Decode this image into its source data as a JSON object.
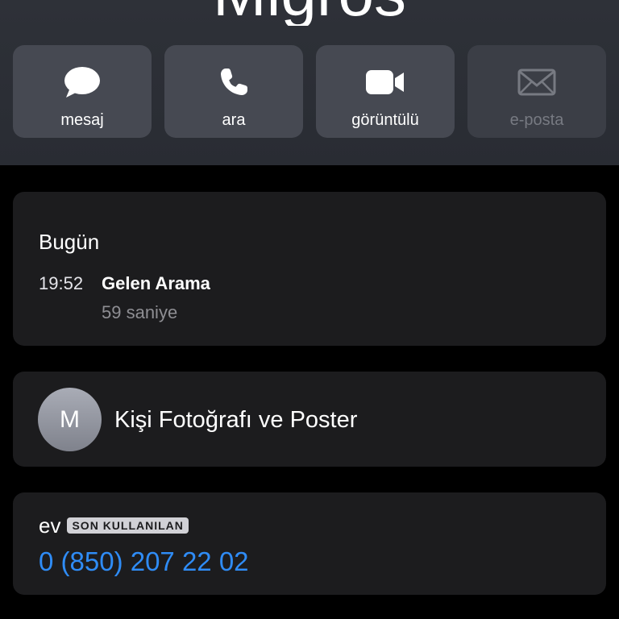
{
  "contact": {
    "name": "Migros"
  },
  "actions": [
    {
      "label": "mesaj",
      "icon": "message-bubble-icon"
    },
    {
      "label": "ara",
      "icon": "phone-icon"
    },
    {
      "label": "görüntülü",
      "icon": "video-camera-icon"
    },
    {
      "label": "e-posta",
      "icon": "envelope-icon",
      "disabled": true
    }
  ],
  "recents": {
    "title": "Bugün",
    "entries": [
      {
        "time": "19:52",
        "type": "Gelen Arama",
        "duration": "59 saniye"
      }
    ]
  },
  "photo": {
    "initial": "M",
    "label": "Kişi Fotoğrafı ve Poster"
  },
  "phone": {
    "label": "ev",
    "badge": "SON KULLANILAN",
    "number": "0 (850) 207 22 02"
  },
  "colors": {
    "background": "#000000",
    "header": "#2c2f36",
    "action_button": "#464952",
    "card": "#1c1c1e",
    "link": "#2f8cf6",
    "secondary_text": "#8e8e93"
  }
}
